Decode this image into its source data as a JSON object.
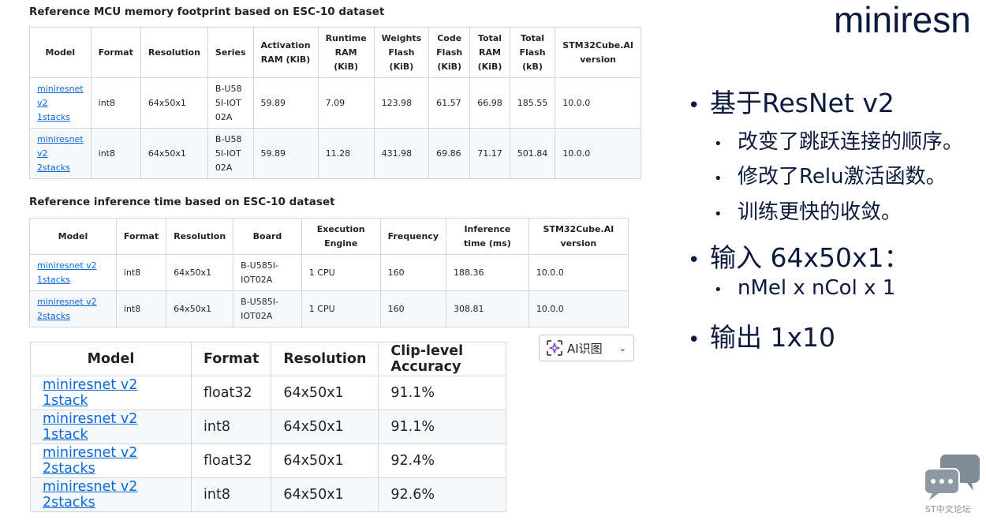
{
  "memory": {
    "title": "Reference MCU memory footprint based on ESC-10 dataset",
    "headers": [
      "Model",
      "Format",
      "Resolution",
      "Series",
      "Activation RAM (KiB)",
      "Runtime RAM (KiB)",
      "Weights Flash (KiB)",
      "Code Flash (KiB)",
      "Total RAM (KiB)",
      "Total Flash (kB)",
      "STM32Cube.AI version"
    ],
    "rows": [
      [
        "miniresnet v2 1stacks",
        "int8",
        "64x50x1",
        "B-U585I-IOT02A",
        "59.89",
        "7.09",
        "123.98",
        "61.57",
        "66.98",
        "185.55",
        "10.0.0"
      ],
      [
        "miniresnet v2 2stacks",
        "int8",
        "64x50x1",
        "B-U585I-IOT02A",
        "59.89",
        "11.28",
        "431.98",
        "69.86",
        "71.17",
        "501.84",
        "10.0.0"
      ]
    ]
  },
  "inference": {
    "title": "Reference inference time based on ESC-10 dataset",
    "headers": [
      "Model",
      "Format",
      "Resolution",
      "Board",
      "Execution Engine",
      "Frequency",
      "Inference time (ms)",
      "STM32Cube.AI version"
    ],
    "rows": [
      [
        "miniresnet v2 1stacks",
        "int8",
        "64x50x1",
        "B-U585I-IOT02A",
        "1 CPU",
        "160",
        "188.36",
        "10.0.0"
      ],
      [
        "miniresnet v2 2stacks",
        "int8",
        "64x50x1",
        "B-U585I-IOT02A",
        "1 CPU",
        "160",
        "308.81",
        "10.0.0"
      ]
    ]
  },
  "accuracy": {
    "headers": [
      "Model",
      "Format",
      "Resolution",
      "Clip-level Accuracy"
    ],
    "rows": [
      [
        "miniresnet v2 1stack",
        "float32",
        "64x50x1",
        "91.1%"
      ],
      [
        "miniresnet v2 1stack",
        "int8",
        "64x50x1",
        "91.1%"
      ],
      [
        "miniresnet v2 2stacks",
        "float32",
        "64x50x1",
        "92.4%"
      ],
      [
        "miniresnet v2 2stacks",
        "int8",
        "64x50x1",
        "92.6%"
      ]
    ]
  },
  "ai_button": {
    "label": "AI识图",
    "icon": "sparkle-icon",
    "chevron": "⌄"
  },
  "slide": {
    "title": "miniresn",
    "bullets": [
      {
        "text": "基于ResNet v2",
        "level": 1
      },
      {
        "text": "改变了跳跃连接的顺序。",
        "level": 2
      },
      {
        "text": "修改了Relu激活函数。",
        "level": 2
      },
      {
        "text": "训练更快的收敛。",
        "level": 2
      },
      {
        "text": "输入 64x50x1：",
        "level": 1
      },
      {
        "text": "nMel x nCol x 1",
        "level": 2
      },
      {
        "text": "输出 1x10",
        "level": 1
      }
    ],
    "bullet_glyph": "•"
  },
  "forum": {
    "caption": "ST中文论坛",
    "icon": "chat-bubbles-icon"
  },
  "colors": {
    "link": "#0969da",
    "slide_text": "#0b1a3d",
    "border": "#d0d7de",
    "stripe": "#f6f8fa"
  }
}
